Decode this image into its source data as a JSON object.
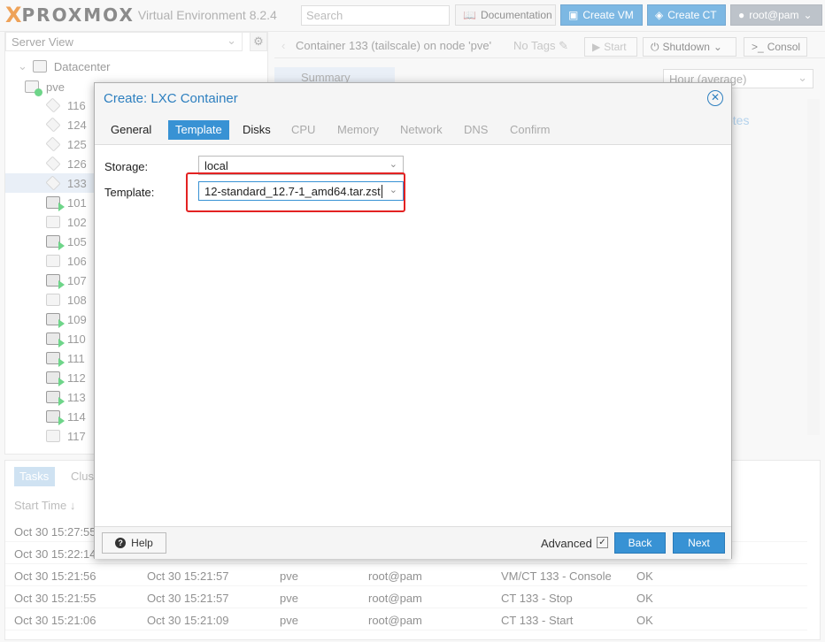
{
  "topbar": {
    "logo_brand": "PROXMOX",
    "logo_product": "Virtual Environment 8.2.4",
    "search_placeholder": "Search",
    "documentation": "Documentation",
    "create_vm": "Create VM",
    "create_ct": "Create CT",
    "user": "root@pam"
  },
  "sidebar": {
    "view": "Server View",
    "datacenter": "Datacenter",
    "node": "pve",
    "items": [
      {
        "label": "116",
        "type": "ct"
      },
      {
        "label": "124",
        "type": "ct"
      },
      {
        "label": "125",
        "type": "ct"
      },
      {
        "label": "126",
        "type": "ct"
      },
      {
        "label": "133",
        "type": "ct-sel"
      },
      {
        "label": "101",
        "type": "vm-run"
      },
      {
        "label": "102",
        "type": "vm"
      },
      {
        "label": "105",
        "type": "vm-run"
      },
      {
        "label": "106",
        "type": "vm"
      },
      {
        "label": "107",
        "type": "vm-run"
      },
      {
        "label": "108",
        "type": "vm"
      },
      {
        "label": "109",
        "type": "vm-run"
      },
      {
        "label": "110",
        "type": "vm-run"
      },
      {
        "label": "111",
        "type": "vm-run"
      },
      {
        "label": "112",
        "type": "vm-run"
      },
      {
        "label": "113",
        "type": "vm-run"
      },
      {
        "label": "114",
        "type": "vm-run"
      },
      {
        "label": "117",
        "type": "vm"
      }
    ]
  },
  "content": {
    "title": "Container 133 (tailscale) on node 'pve'",
    "no_tags": "No Tags",
    "start": "Start",
    "shutdown": "Shutdown",
    "console": "Consol",
    "summary_tab": "Summary",
    "timeframe": "Hour (average)",
    "notes": "otes"
  },
  "tasks": {
    "tab_tasks": "Tasks",
    "tab_cluster": "Clus",
    "col_start": "Start Time ↓",
    "rows": [
      {
        "start": "Oct 30 15:27:55",
        "end": "",
        "node": "",
        "user": "",
        "desc": "",
        "status": ""
      },
      {
        "start": "Oct 30 15:22:14",
        "end": "",
        "node": "",
        "user": "",
        "desc": "",
        "status": ""
      },
      {
        "start": "Oct 30 15:21:56",
        "end": "Oct 30 15:21:57",
        "node": "pve",
        "user": "root@pam",
        "desc": "VM/CT 133 - Console",
        "status": "OK"
      },
      {
        "start": "Oct 30 15:21:55",
        "end": "Oct 30 15:21:57",
        "node": "pve",
        "user": "root@pam",
        "desc": "CT 133 - Stop",
        "status": "OK"
      },
      {
        "start": "Oct 30 15:21:06",
        "end": "Oct 30 15:21:09",
        "node": "pve",
        "user": "root@pam",
        "desc": "CT 133 - Start",
        "status": "OK"
      }
    ]
  },
  "modal": {
    "title": "Create: LXC Container",
    "tabs": [
      "General",
      "Template",
      "Disks",
      "CPU",
      "Memory",
      "Network",
      "DNS",
      "Confirm"
    ],
    "storage_label": "Storage:",
    "storage_value": "local",
    "template_label": "Template:",
    "template_value": "12-standard_12.7-1_amd64.tar.zst",
    "help": "Help",
    "advanced": "Advanced",
    "back": "Back",
    "next": "Next"
  }
}
